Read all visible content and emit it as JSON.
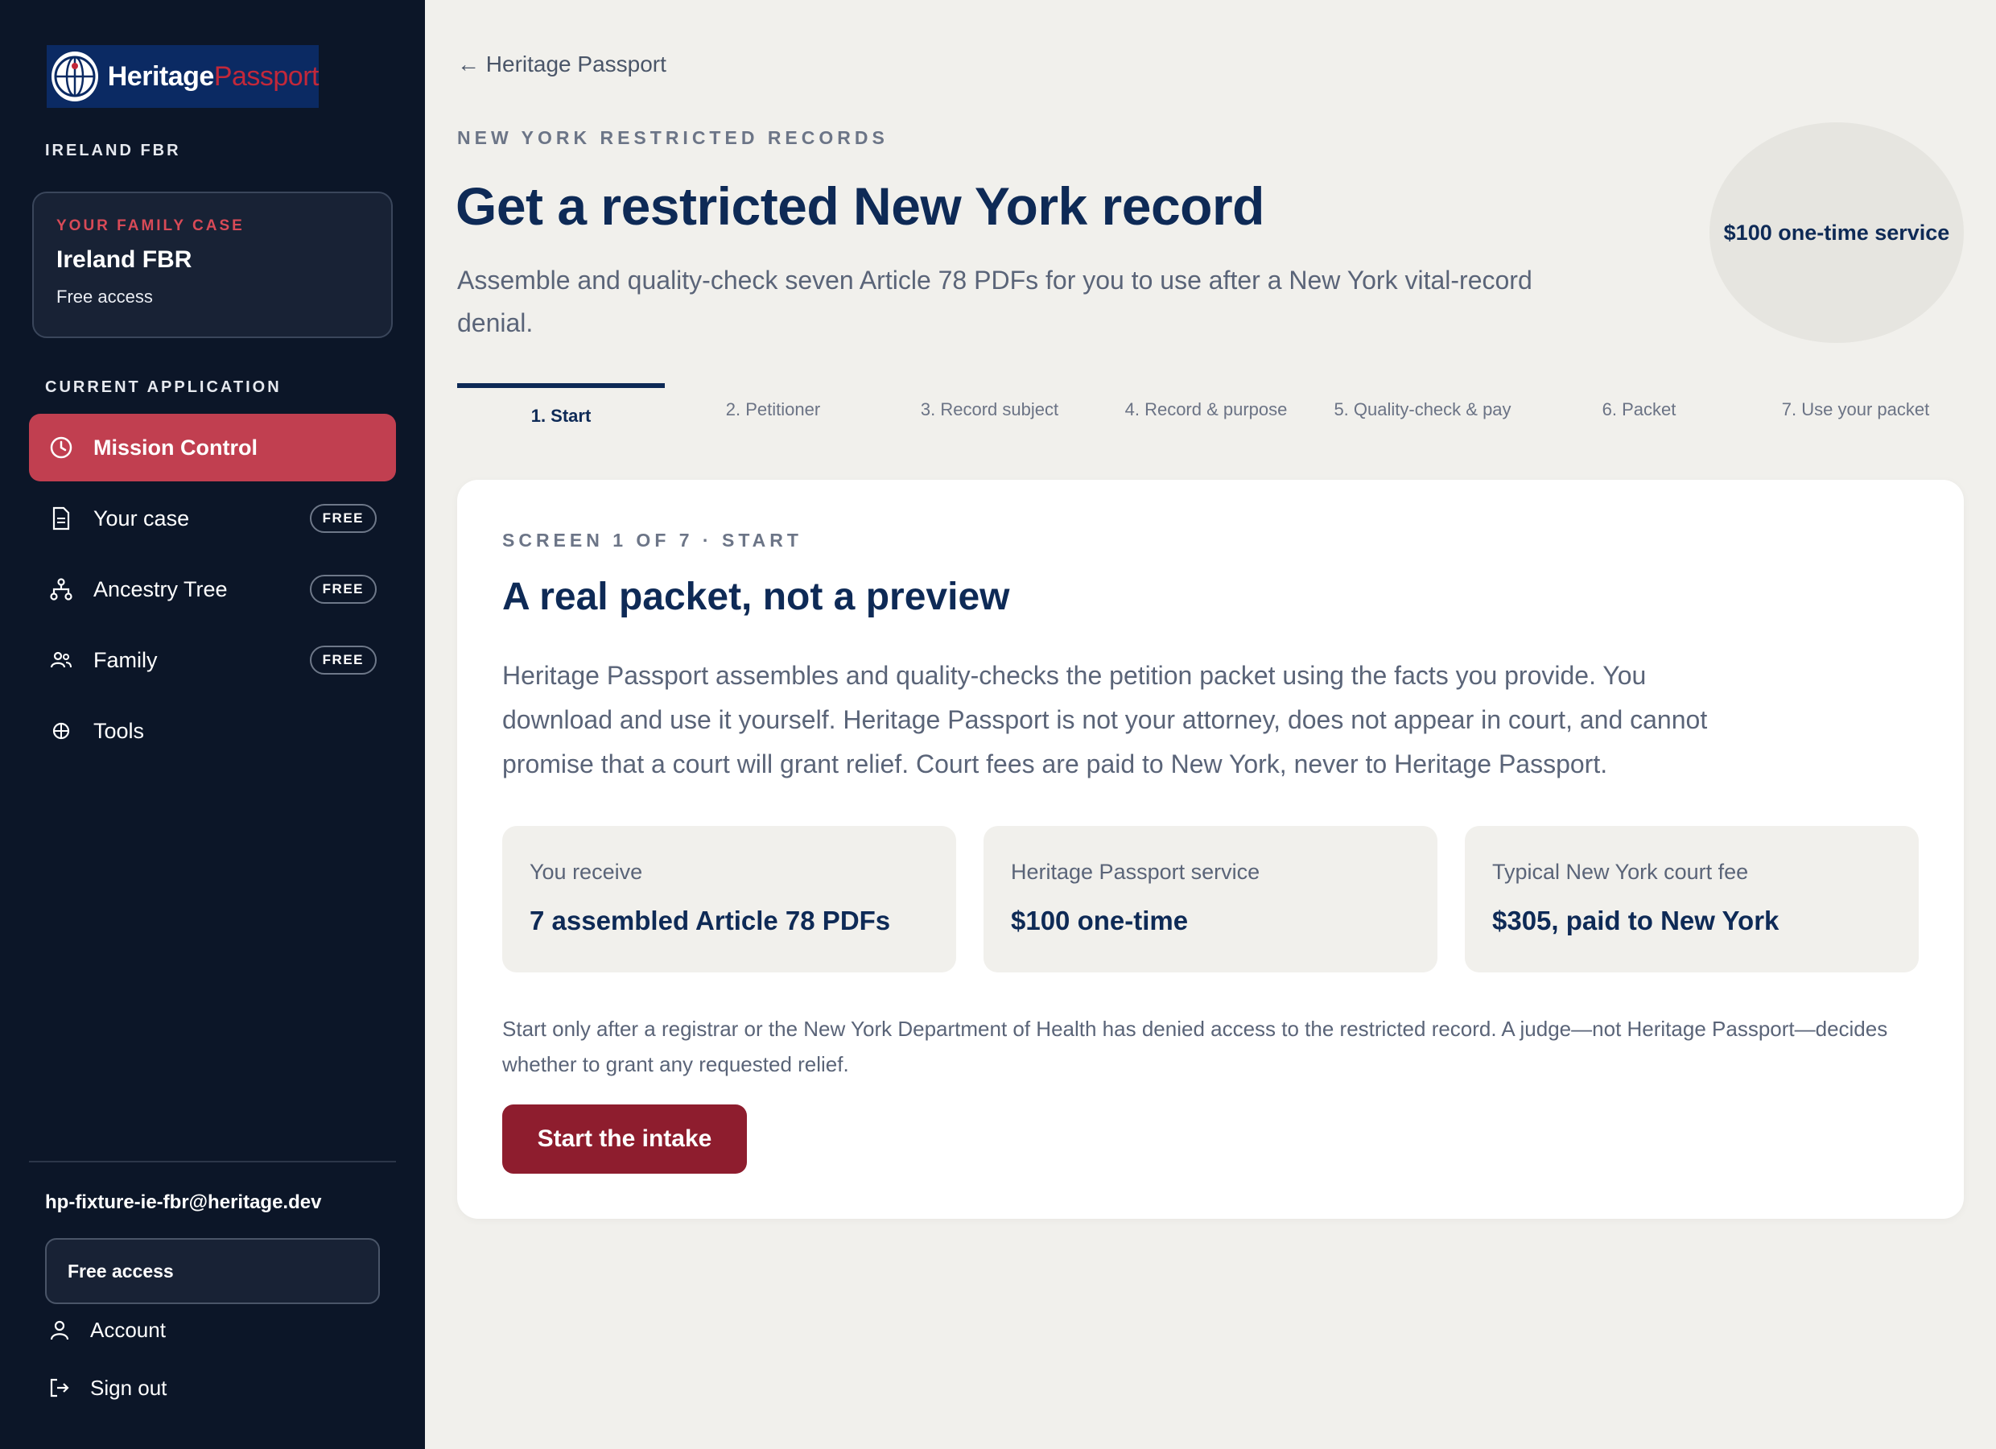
{
  "brand": {
    "part1": "Heritage",
    "part2": "Passport"
  },
  "sidebar": {
    "program_label": "IRELAND FBR",
    "case_card": {
      "eyebrow": "YOUR FAMILY CASE",
      "name": "Ireland FBR",
      "access": "Free access"
    },
    "current_application_label": "CURRENT APPLICATION",
    "items": [
      {
        "label": "Mission Control",
        "icon": "clock-icon",
        "active": true
      },
      {
        "label": "Your case",
        "icon": "document-icon",
        "badge": "FREE"
      },
      {
        "label": "Ancestry Tree",
        "icon": "tree-icon",
        "badge": "FREE"
      },
      {
        "label": "Family",
        "icon": "people-icon",
        "badge": "FREE"
      },
      {
        "label": "Tools",
        "icon": "tools-icon"
      }
    ],
    "user_email": "hp-fixture-ie-fbr@heritage.dev",
    "access_plan": "Free access",
    "account_label": "Account",
    "signout_label": "Sign out"
  },
  "main": {
    "back_link": "← Heritage Passport",
    "eyebrow": "NEW YORK RESTRICTED RECORDS",
    "title": "Get a restricted New York record",
    "description": "Assemble and quality-check seven Article 78 PDFs for you to use after a New York vital-record denial.",
    "price_badge": "$100 one-time service",
    "steps": [
      "1. Start",
      "2. Petitioner",
      "3. Record subject",
      "4. Record & purpose",
      "5. Quality-check & pay",
      "6. Packet",
      "7. Use your packet"
    ],
    "card": {
      "eyebrow": "SCREEN 1 OF 7 · START",
      "title": "A real packet, not a preview",
      "body": "Heritage Passport assembles and quality-checks the petition packet using the facts you provide. You download and use it yourself. Heritage Passport is not your attorney, does not appear in court, and cannot promise that a court will grant relief. Court fees are paid to New York, never to Heritage Passport.",
      "info": [
        {
          "label": "You receive",
          "value": "7 assembled Article 78 PDFs"
        },
        {
          "label": "Heritage Passport service",
          "value": "$100 one-time"
        },
        {
          "label": "Typical New York court fee",
          "value": "$305, paid to New York"
        }
      ],
      "note": "Start only after a registrar or the New York Department of Health has denied access to the restricted record. A judge—not Heritage Passport—decides whether to grant any requested relief.",
      "cta": "Start the intake"
    }
  },
  "colors": {
    "sidebar_bg": "#0c1628",
    "accent_red": "#c13f50",
    "cta_red": "#8e1d2e",
    "navy": "#0e2a56",
    "page_bg": "#f1f0ec"
  }
}
